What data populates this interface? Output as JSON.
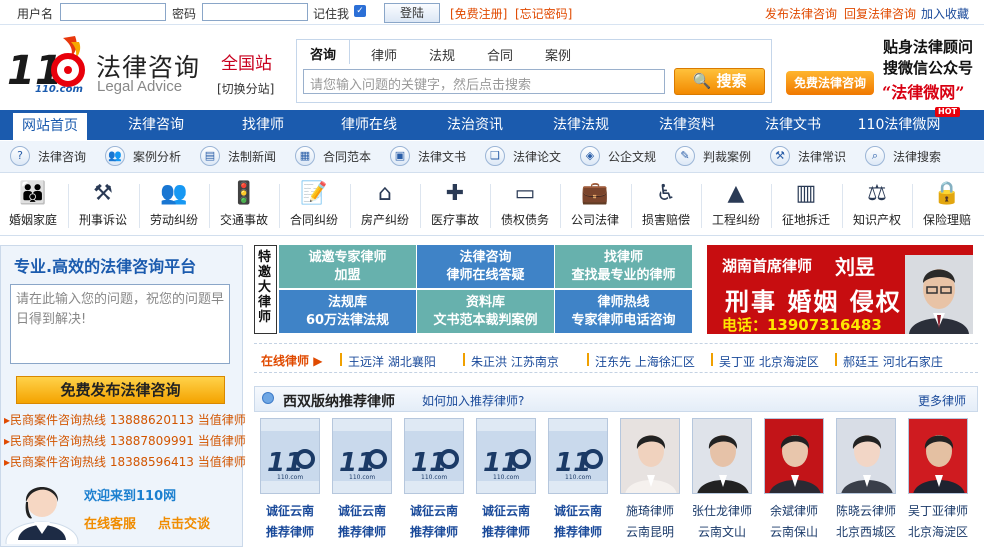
{
  "topbar": {
    "username_label": "用户名",
    "password_label": "密码",
    "remember_label": "记住我",
    "login_button": "登陆",
    "register_link": "[免费注册]",
    "forgot_link": "[忘记密码]",
    "post_link": "发布法律咨询",
    "reply_link": "回复法律咨询",
    "favorite_link": "加入收藏"
  },
  "header": {
    "logo_text": "110",
    "logo_sub": "110.com",
    "title": "法律咨询",
    "subtitle": "Legal Advice",
    "site_label": "全国站",
    "switch_label": "[切换分站]",
    "search_tabs": [
      "咨询",
      "律师",
      "法规",
      "合同",
      "案例"
    ],
    "search_placeholder": "请您输入问题的关键字，然后点击搜索",
    "search_button": "搜索",
    "free_button": "免费法律咨询",
    "promo_line1": "贴身法律顾问",
    "promo_line2": "搜微信公众号",
    "promo_line3": "“法律微网”"
  },
  "mainnav": {
    "items": [
      "网站首页",
      "法律咨询",
      "找律师",
      "律师在线",
      "法治资讯",
      "法律法规",
      "法律资料",
      "法律文书",
      "110法律微网"
    ],
    "hot_badge": "HOT"
  },
  "subnav": {
    "items": [
      "法律咨询",
      "案例分析",
      "法制新闻",
      "合同范本",
      "法律文书",
      "法律论文",
      "公企文规",
      "判裁案例",
      "法律常识",
      "法律搜索"
    ]
  },
  "categories": {
    "items": [
      {
        "label": "婚姻家庭",
        "icon": "family-icon"
      },
      {
        "label": "刑事诉讼",
        "icon": "gavel-icon"
      },
      {
        "label": "劳动纠纷",
        "icon": "workers-icon"
      },
      {
        "label": "交通事故",
        "icon": "traffic-light-icon"
      },
      {
        "label": "合同纠纷",
        "icon": "contract-icon"
      },
      {
        "label": "房产纠纷",
        "icon": "house-icon"
      },
      {
        "label": "医疗事故",
        "icon": "medical-kit-icon"
      },
      {
        "label": "债权债务",
        "icon": "card-icon"
      },
      {
        "label": "公司法律",
        "icon": "briefcase-icon"
      },
      {
        "label": "损害赔偿",
        "icon": "wheelchair-icon"
      },
      {
        "label": "工程纠纷",
        "icon": "cone-icon"
      },
      {
        "label": "征地拆迁",
        "icon": "building-icon"
      },
      {
        "label": "知识产权",
        "icon": "scales-icon"
      },
      {
        "label": "保险理赔",
        "icon": "lock-icon"
      }
    ]
  },
  "left": {
    "title": "专业.高效的法律咨询平台",
    "textarea_placeholder": "请在此输入您的问题，祝您的问题早日得到解决!",
    "post_button": "免费发布法律咨询",
    "hotlines": [
      {
        "label": "民商案件咨询热线",
        "number": "13888620113",
        "who": "当值律师"
      },
      {
        "label": "民商案件咨询热线",
        "number": "13887809991",
        "who": "当值律师"
      },
      {
        "label": "民商案件咨询热线",
        "number": "18388596413",
        "who": "当值律师"
      }
    ],
    "welcome": "欢迎来到110网",
    "online_service": "在线客服",
    "click_chat": "点击交谈"
  },
  "special": {
    "label": "特邀大律师",
    "tiles": [
      {
        "line1": "诚邀专家律师",
        "line2": "加盟",
        "color": "#67b1ad"
      },
      {
        "line1": "法律咨询",
        "line2": "律师在线答疑",
        "color": "#3f83c7"
      },
      {
        "line1": "找律师",
        "line2": "查找最专业的律师",
        "color": "#67b1ad"
      },
      {
        "line1": "法规库",
        "line2": "60万法律法规",
        "color": "#3f83c7"
      },
      {
        "line1": "资料库",
        "line2": "文书范本裁判案例",
        "color": "#67b1ad"
      },
      {
        "line1": "律师热线",
        "line2": "专家律师电话咨询",
        "color": "#3f83c7"
      }
    ]
  },
  "ad": {
    "line1": "湖南首席律师",
    "name": "刘昱",
    "line2": "刑事 婚姻 侵权",
    "phone": "电话：13907316483"
  },
  "online": {
    "label": "在线律师",
    "items": [
      "王远洋 湖北襄阳",
      "朱正洪 江苏南京",
      "汪东先 上海徐汇区",
      "吴丁亚 北京海淀区",
      "郝廷王 河北石家庄"
    ]
  },
  "recommend": {
    "title": "西双版纳推荐律师",
    "how": "如何加入推荐律师?",
    "more": "更多律师",
    "cards": [
      {
        "n1": "诚征云南",
        "n2": "推荐律师",
        "photo": false
      },
      {
        "n1": "诚征云南",
        "n2": "推荐律师",
        "photo": false
      },
      {
        "n1": "诚征云南",
        "n2": "推荐律师",
        "photo": false
      },
      {
        "n1": "诚征云南",
        "n2": "推荐律师",
        "photo": false
      },
      {
        "n1": "诚征云南",
        "n2": "推荐律师",
        "photo": false
      },
      {
        "n1": "施琦律师",
        "n2": "云南昆明",
        "photo": true
      },
      {
        "n1": "张仕龙律师",
        "n2": "云南文山",
        "photo": true
      },
      {
        "n1": "余斌律师",
        "n2": "云南保山",
        "photo": true
      },
      {
        "n1": "陈晓云律师",
        "n2": "北京西城区",
        "photo": true
      },
      {
        "n1": "吴丁亚律师",
        "n2": "北京海淀区",
        "photo": true
      }
    ]
  }
}
